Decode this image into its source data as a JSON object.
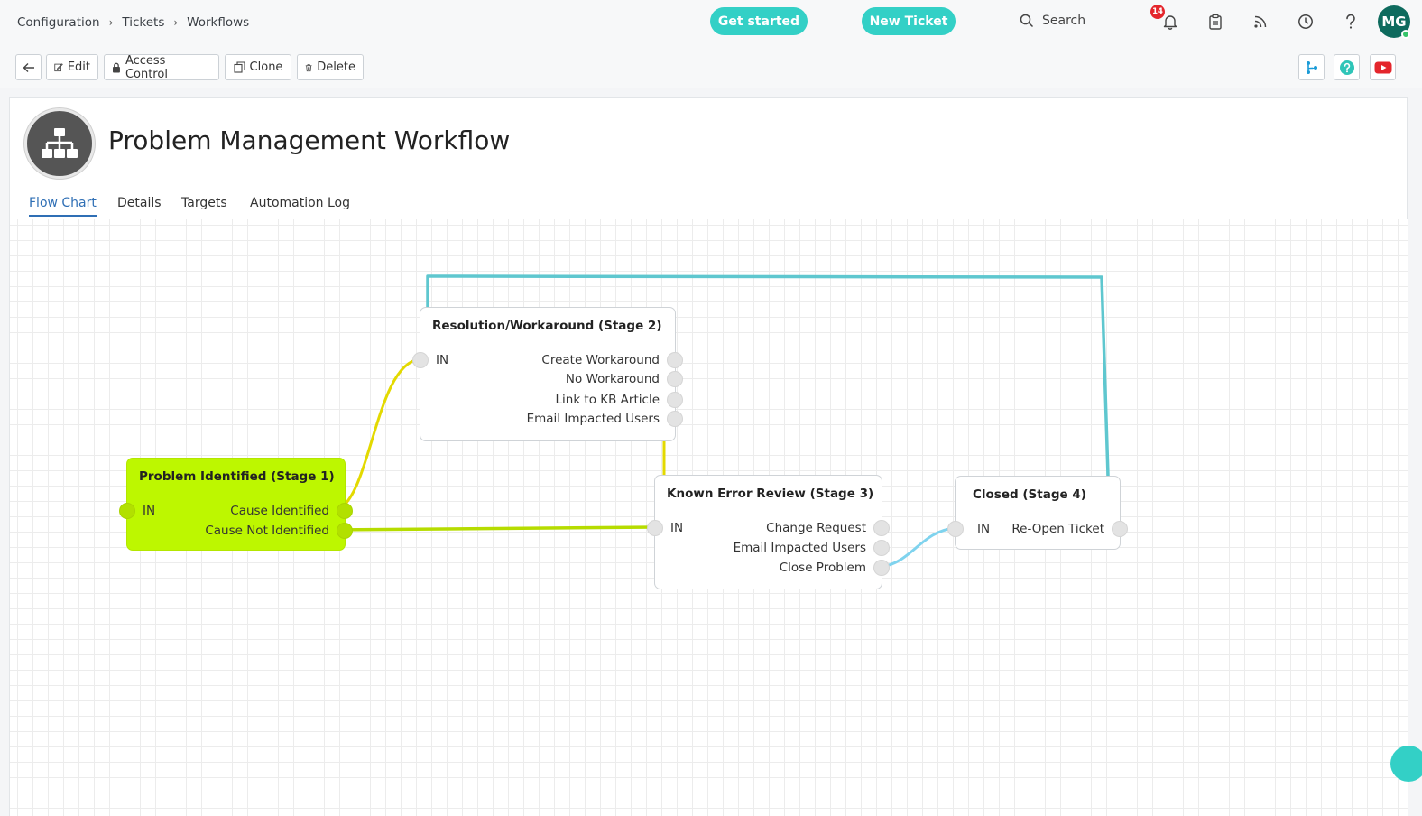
{
  "breadcrumb": [
    "Configuration",
    "Tickets",
    "Workflows"
  ],
  "header": {
    "get_started": "Get started",
    "new_ticket": "New Ticket",
    "search_label": "Search",
    "notification_count": "14",
    "avatar_initials": "MG"
  },
  "toolbar": {
    "edit": "Edit",
    "access_control": "Access Control",
    "clone": "Clone",
    "delete": "Delete"
  },
  "workflow": {
    "title": "Problem Management Workflow"
  },
  "tabs": [
    "Flow Chart",
    "Details",
    "Targets",
    "Automation Log"
  ],
  "active_tab": "Flow Chart",
  "flowchart": {
    "stage1": {
      "title": "Problem Identified (Stage 1)",
      "in": "IN",
      "outputs": [
        "Cause Identified",
        "Cause Not Identified"
      ]
    },
    "stage2": {
      "title": "Resolution/Workaround (Stage 2)",
      "in": "IN",
      "outputs": [
        "Create Workaround",
        "No Workaround",
        "Link to KB Article",
        "Email Impacted Users"
      ]
    },
    "stage3": {
      "title": "Known Error Review (Stage 3)",
      "in": "IN",
      "outputs": [
        "Change Request",
        "Email Impacted Users",
        "Close Problem"
      ]
    },
    "stage4": {
      "title": "Closed (Stage 4)",
      "in": "IN",
      "outputs": [
        "Re-Open Ticket"
      ]
    },
    "colors": {
      "stage1_fill": "#bdf700",
      "wire_yellow": "#e3d900",
      "wire_green": "#b6dc00",
      "wire_teal": "#5fc7cf",
      "wire_blue": "#7fd3ee"
    }
  }
}
